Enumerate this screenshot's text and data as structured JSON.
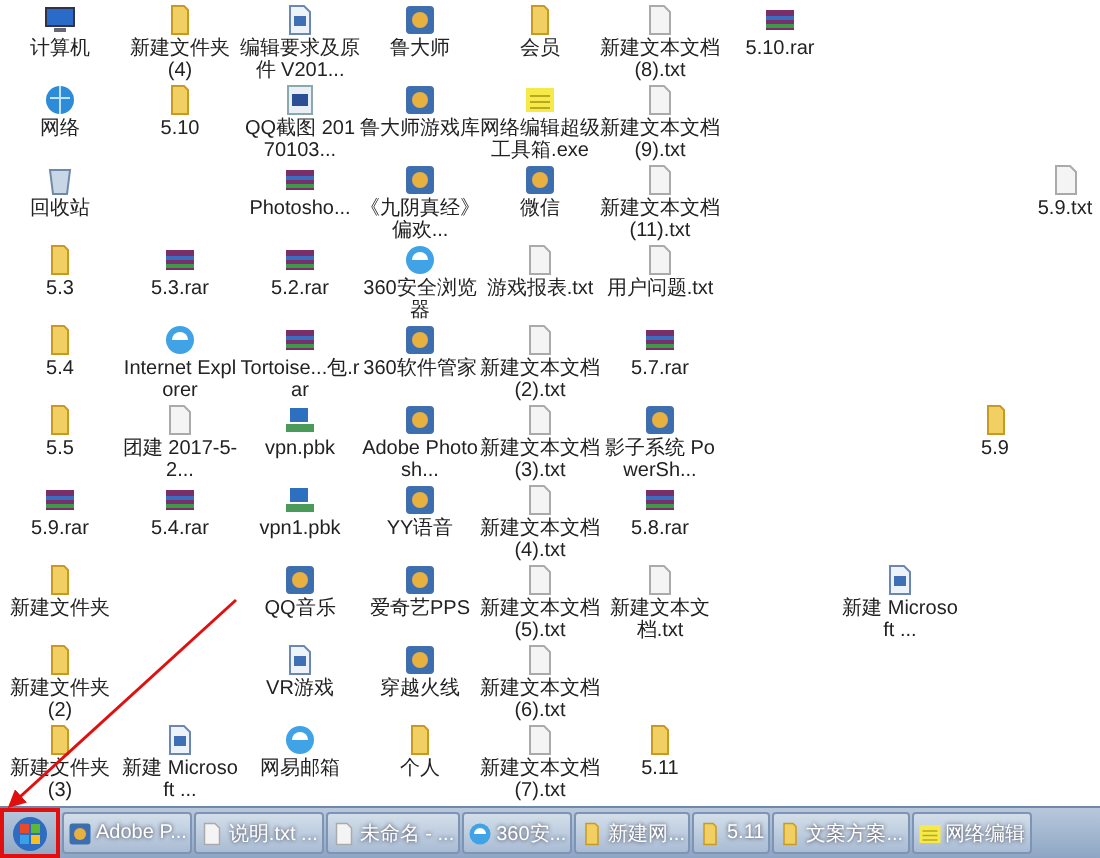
{
  "desktop": {
    "rows": [
      [
        {
          "label": "计算机",
          "kind": "computer"
        },
        {
          "label": "新建文件夹 (4)",
          "kind": "folder"
        },
        {
          "label": "编辑要求及原件 V201...",
          "kind": "document"
        },
        {
          "label": "鲁大师",
          "kind": "app"
        },
        {
          "label": "会员",
          "kind": "folder"
        },
        {
          "label": "新建文本文档 (8).txt",
          "kind": "text"
        },
        {
          "label": "5.10.rar",
          "kind": "archive"
        }
      ],
      [
        {
          "label": "网络",
          "kind": "network"
        },
        {
          "label": "5.10",
          "kind": "folder"
        },
        {
          "label": "QQ截图 20170103...",
          "kind": "image"
        },
        {
          "label": "鲁大师游戏库",
          "kind": "app"
        },
        {
          "label": "网络编辑超级工具箱.exe",
          "kind": "notes"
        },
        {
          "label": "新建文本文档 (9).txt",
          "kind": "text"
        }
      ],
      [
        {
          "label": "回收站",
          "kind": "trash"
        },
        null,
        {
          "label": "Photosho...",
          "kind": "archive"
        },
        {
          "label": "《九阴真经》偏欢...",
          "kind": "app"
        },
        {
          "label": "微信",
          "kind": "app"
        },
        {
          "label": "新建文本文档 (11).txt",
          "kind": "text"
        },
        null,
        null,
        null,
        {
          "label": "5.9.txt",
          "kind": "text"
        }
      ],
      [
        {
          "label": "5.3",
          "kind": "folder"
        },
        {
          "label": "5.3.rar",
          "kind": "archive"
        },
        {
          "label": "5.2.rar",
          "kind": "archive"
        },
        {
          "label": "360安全浏览器",
          "kind": "browser"
        },
        {
          "label": "游戏报表.txt",
          "kind": "text"
        },
        {
          "label": "用户问题.txt",
          "kind": "text"
        }
      ],
      [
        {
          "label": "5.4",
          "kind": "folder"
        },
        {
          "label": "Internet Explorer",
          "kind": "browser"
        },
        {
          "label": "Tortoise...包.rar",
          "kind": "archive"
        },
        {
          "label": "360软件管家",
          "kind": "app"
        },
        {
          "label": "新建文本文档 (2).txt",
          "kind": "text"
        },
        {
          "label": "5.7.rar",
          "kind": "archive"
        }
      ],
      [
        {
          "label": "5.5",
          "kind": "folder"
        },
        {
          "label": "团建 2017-5-2...",
          "kind": "text"
        },
        {
          "label": "vpn.pbk",
          "kind": "connection"
        },
        {
          "label": "Adobe Photosh...",
          "kind": "app"
        },
        {
          "label": "新建文本文档 (3).txt",
          "kind": "text"
        },
        {
          "label": "影子系统 PowerSh...",
          "kind": "app"
        },
        null,
        null,
        {
          "label": "5.9",
          "kind": "folder"
        }
      ],
      [
        {
          "label": "5.9.rar",
          "kind": "archive"
        },
        {
          "label": "5.4.rar",
          "kind": "archive"
        },
        {
          "label": "vpn1.pbk",
          "kind": "connection"
        },
        {
          "label": "YY语音",
          "kind": "app"
        },
        {
          "label": "新建文本文档 (4).txt",
          "kind": "text"
        },
        {
          "label": "5.8.rar",
          "kind": "archive"
        }
      ],
      [
        {
          "label": "新建文件夹",
          "kind": "folder"
        },
        null,
        {
          "label": "QQ音乐",
          "kind": "app"
        },
        {
          "label": "爱奇艺PPS",
          "kind": "app"
        },
        {
          "label": "新建文本文档 (5).txt",
          "kind": "text"
        },
        {
          "label": "新建文本文档.txt",
          "kind": "text"
        },
        null,
        {
          "label": "新建 Microsoft ...",
          "kind": "document"
        }
      ],
      [
        {
          "label": "新建文件夹 (2)",
          "kind": "folder"
        },
        null,
        {
          "label": "VR游戏",
          "kind": "document"
        },
        {
          "label": "穿越火线",
          "kind": "app"
        },
        {
          "label": "新建文本文档 (6).txt",
          "kind": "text"
        }
      ],
      [
        {
          "label": "新建文件夹 (3)",
          "kind": "folder"
        },
        {
          "label": "新建 Microsoft ...",
          "kind": "document"
        },
        {
          "label": "网易邮箱",
          "kind": "browser"
        },
        {
          "label": "个人",
          "kind": "folder"
        },
        {
          "label": "新建文本文档 (7).txt",
          "kind": "text"
        },
        {
          "label": "5.11",
          "kind": "folder"
        }
      ]
    ]
  },
  "taskbar": {
    "start_button": {
      "highlighted": true
    },
    "items": [
      {
        "label": "Adobe P...",
        "kind": "app"
      },
      {
        "label": "说明.txt ...",
        "kind": "text"
      },
      {
        "label": "未命名 - ...",
        "kind": "text"
      },
      {
        "label": "360安...",
        "kind": "browser"
      },
      {
        "label": "新建网...",
        "kind": "folder"
      },
      {
        "label": "5.11",
        "kind": "folder"
      },
      {
        "label": "文案方案...",
        "kind": "folder"
      },
      {
        "label": "网络编辑",
        "kind": "notes"
      }
    ]
  }
}
